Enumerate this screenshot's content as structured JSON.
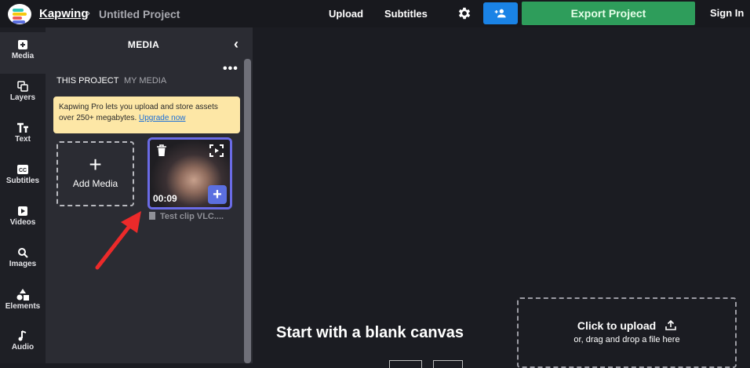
{
  "header": {
    "brand": "Kapwing",
    "separator": "›",
    "project_title": "Untitled Project",
    "nav": [
      "Upload",
      "Subtitles"
    ],
    "export_label": "Export Project",
    "signin_label": "Sign In"
  },
  "sidebar": {
    "items": [
      {
        "label": "Media",
        "icon": "media-icon"
      },
      {
        "label": "Layers",
        "icon": "layers-icon"
      },
      {
        "label": "Text",
        "icon": "text-icon"
      },
      {
        "label": "Subtitles",
        "icon": "subtitles-icon"
      },
      {
        "label": "Videos",
        "icon": "videos-icon"
      },
      {
        "label": "Images",
        "icon": "images-icon"
      },
      {
        "label": "Elements",
        "icon": "elements-icon"
      },
      {
        "label": "Audio",
        "icon": "audio-icon"
      }
    ]
  },
  "panel": {
    "title": "MEDIA",
    "collapse_glyph": "‹",
    "more_glyph": "•••",
    "tabs": [
      "THIS PROJECT",
      "MY MEDIA"
    ],
    "notice_text": "Kapwing Pro lets you upload and store assets over 250+ megabytes.",
    "notice_link": "Upgrade now",
    "add_media_label": "Add Media",
    "clip": {
      "duration": "00:09",
      "name": "Test clip VLC...."
    }
  },
  "canvas": {
    "blank_title": "Start with a blank canvas",
    "upload_main": "Click to upload",
    "upload_sub": "or, drag and drop a file here"
  },
  "colors": {
    "accent_blue": "#1a83e6",
    "export_green": "#2e9d5b",
    "clip_border": "#6a6be6",
    "notice_bg": "#fde7a6"
  }
}
